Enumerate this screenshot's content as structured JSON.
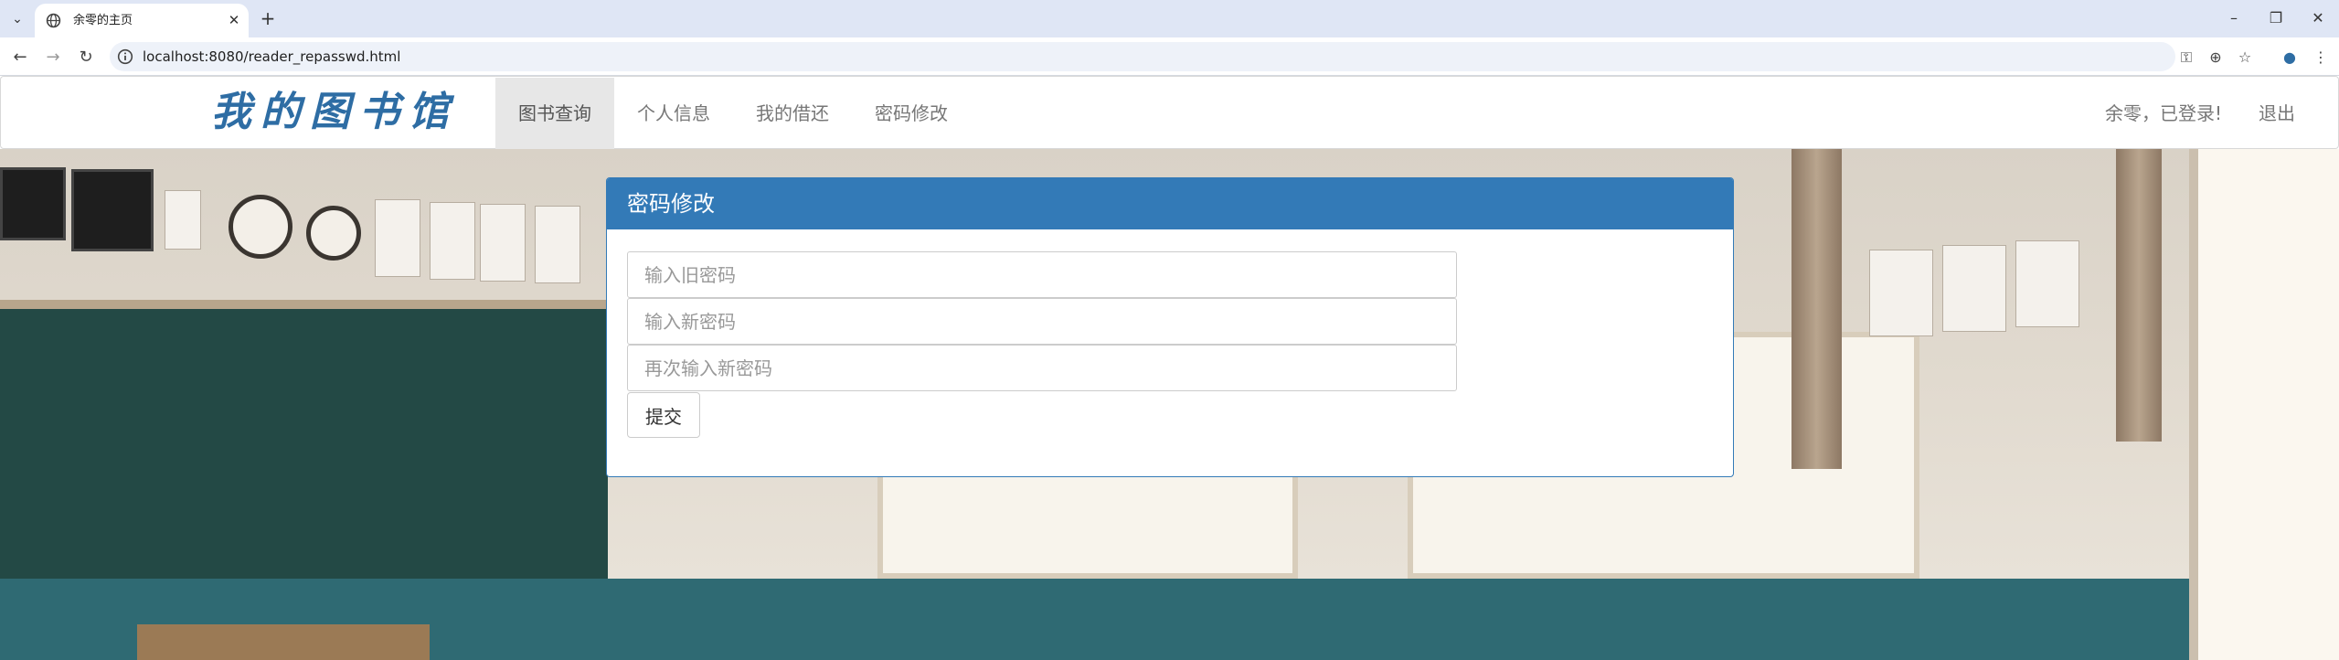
{
  "browser": {
    "tab_title": "余零的主页",
    "url": "localhost:8080/reader_repasswd.html"
  },
  "navbar": {
    "brand": "我的图书馆",
    "items": [
      {
        "label": "图书查询",
        "active": true
      },
      {
        "label": "个人信息",
        "active": false
      },
      {
        "label": "我的借还",
        "active": false
      },
      {
        "label": "密码修改",
        "active": false
      }
    ],
    "user_status": "余零，已登录!",
    "logout_label": "退出"
  },
  "panel": {
    "title": "密码修改",
    "old_password_placeholder": "输入旧密码",
    "new_password_placeholder": "输入新密码",
    "confirm_password_placeholder": "再次输入新密码",
    "submit_label": "提交"
  },
  "colors": {
    "primary": "#337ab7",
    "tab_strip": "#dfe6f5"
  },
  "icons": [
    "tab-search-icon",
    "globe-favicon-icon",
    "close-icon",
    "plus-icon",
    "minimize-icon",
    "restore-icon",
    "back-icon",
    "forward-icon",
    "reload-icon",
    "site-info-icon",
    "password-key-icon",
    "zoom-icon",
    "bookmark-star-icon",
    "profile-icon",
    "menu-icon"
  ]
}
